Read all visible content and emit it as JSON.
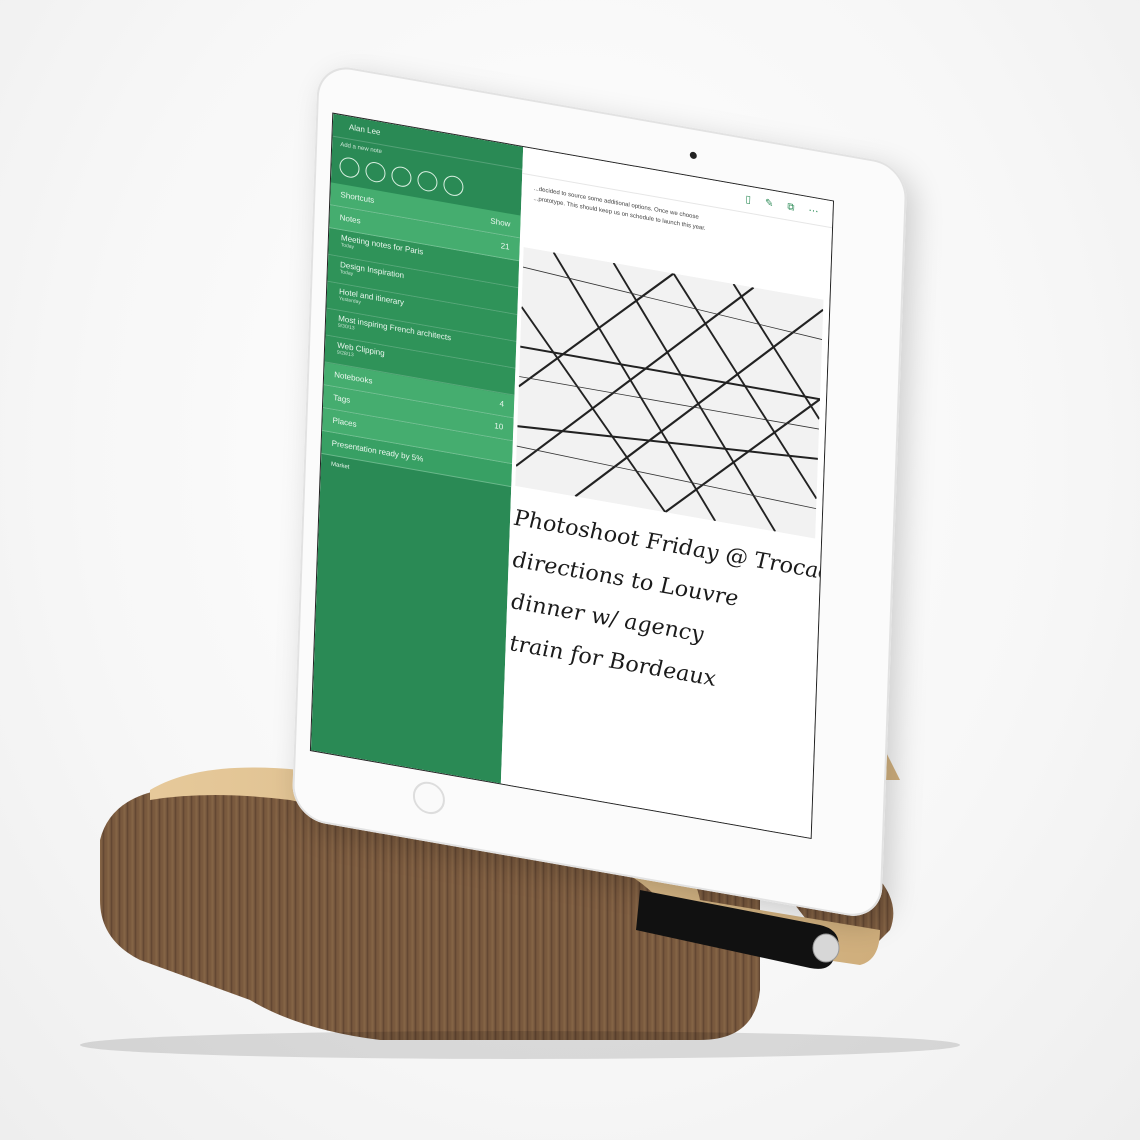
{
  "app": {
    "user_name": "Alan Lee",
    "quick_actions_label": "Add a new note"
  },
  "sidebar": {
    "sections": [
      {
        "label": "Shortcuts",
        "count": "Show"
      },
      {
        "label": "Notes",
        "count": "21"
      },
      {
        "label": "Notebooks",
        "count": "4"
      },
      {
        "label": "Tags",
        "count": "10"
      },
      {
        "label": "Places",
        "count": ""
      }
    ],
    "notes": [
      {
        "title": "Meeting notes for Paris",
        "sub": "Today"
      },
      {
        "title": "Design Inspiration",
        "sub": "Today"
      },
      {
        "title": "Hotel and itinerary",
        "sub": "Yesterday"
      },
      {
        "title": "Most inspiring French architects",
        "sub": "9/30/13"
      },
      {
        "title": "Web Clipping",
        "sub": "9/28/13"
      }
    ],
    "reminder": "Presentation ready by 5%",
    "market": "Market"
  },
  "note": {
    "line1": "...decided to source some additional options. Once we choose",
    "line2": "...prototype. This should keep us on schedule to launch this year.",
    "handwriting": [
      "Photoshoot Friday @ Trocadero",
      "directions to Louvre",
      "dinner w/ agency",
      "train for Bordeaux"
    ]
  },
  "colors": {
    "sidebar_green": "#2a8a55",
    "wood": "#7b5a3f",
    "plywood_edge": "#d9b98a"
  },
  "icons": [
    "home-button",
    "camera",
    "stylus"
  ]
}
